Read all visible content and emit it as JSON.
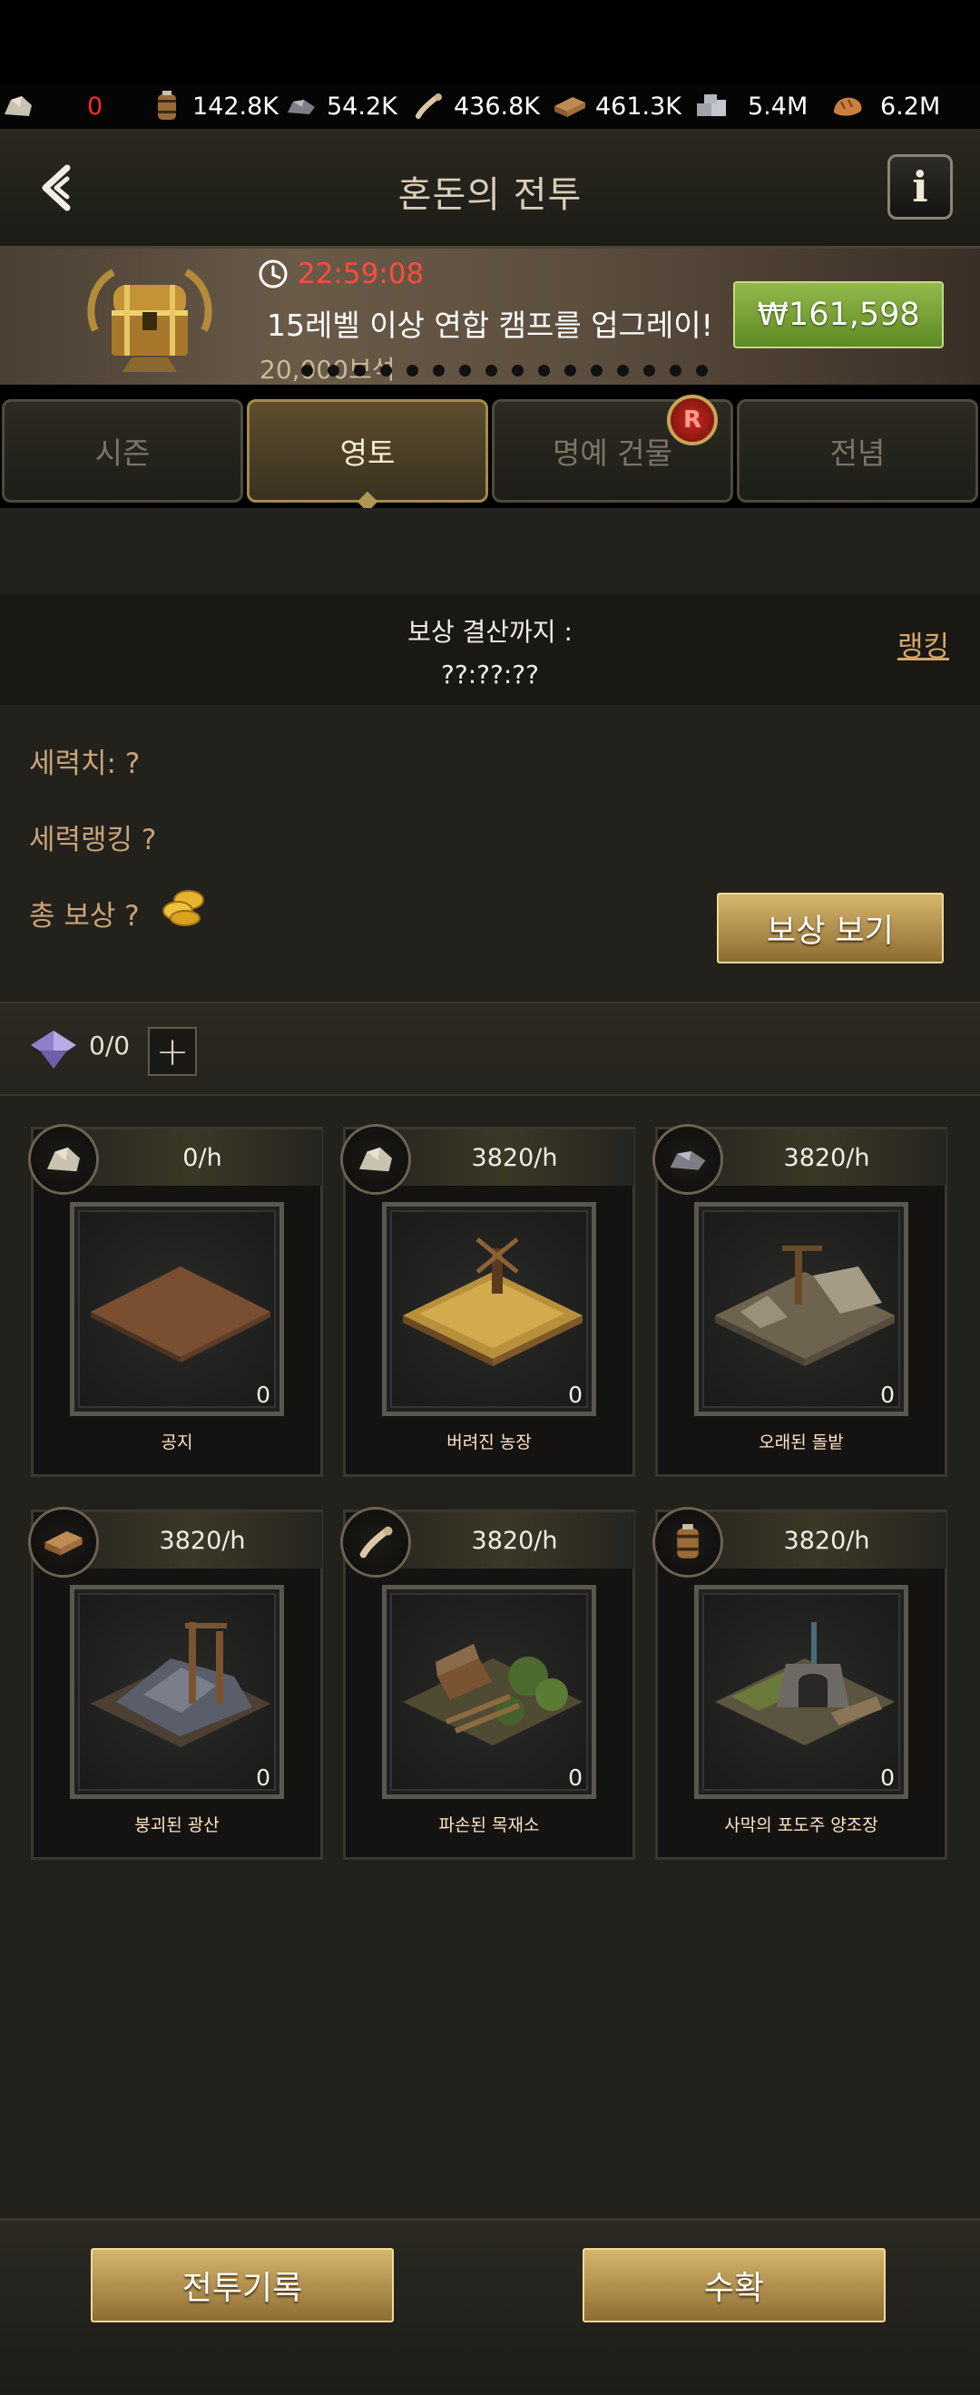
{
  "resources": [
    {
      "icon": "stone-ore-icon",
      "value": "0",
      "highlight": true
    },
    {
      "icon": "wine-barrel-icon",
      "value": "142.8K"
    },
    {
      "icon": "iron-ore-icon",
      "value": "54.2K"
    },
    {
      "icon": "bone-icon",
      "value": "436.8K"
    },
    {
      "icon": "wood-icon",
      "value": "461.3K"
    },
    {
      "icon": "metal-icon",
      "value": "5.4M"
    },
    {
      "icon": "bread-icon",
      "value": "6.2M"
    }
  ],
  "header": {
    "title": "혼돈의 전투"
  },
  "promo": {
    "timer": "22:59:08",
    "text": "15레벨 이상 연합 캠프를 업그레이!",
    "sub": "20,000보석",
    "price": "₩161,598",
    "dot_count": 16
  },
  "tabs": [
    {
      "label": "시즌",
      "active": false
    },
    {
      "label": "영토",
      "active": true
    },
    {
      "label": "명예 건물",
      "active": false,
      "badge": "R"
    },
    {
      "label": "전념",
      "active": false
    }
  ],
  "settlement": {
    "label": "보상 결산까지 :",
    "time": "??:??:??",
    "ranking_link": "랭킹"
  },
  "stats": {
    "power": "세력치: ?",
    "power_rank": "세력랭킹 ?",
    "total_reward": "총 보상 ?"
  },
  "reward_button": "보상 보기",
  "slots": {
    "count": "0/0",
    "plus": "+"
  },
  "territories": [
    {
      "name": "공지",
      "rate": "0/h",
      "icon": "stone-ore-icon",
      "count": "0"
    },
    {
      "name": "버려진 농장",
      "rate": "3820/h",
      "icon": "stone-ore-icon",
      "count": "0"
    },
    {
      "name": "오래된 돌밭",
      "rate": "3820/h",
      "icon": "iron-ore-icon",
      "count": "0"
    },
    {
      "name": "붕괴된 광산",
      "rate": "3820/h",
      "icon": "wood-icon",
      "count": "0"
    },
    {
      "name": "파손된 목재소",
      "rate": "3820/h",
      "icon": "bone-icon",
      "count": "0"
    },
    {
      "name": "사막의 포도주 양조장",
      "rate": "3820/h",
      "icon": "wine-barrel-icon",
      "count": "0"
    }
  ],
  "bottom": {
    "battle_log": "전투기록",
    "harvest": "수확"
  },
  "colors": {
    "accent_gold": "#b09554",
    "price_green": "#7aa83a",
    "timer_red": "#ff4d3d",
    "link_orange": "#d6a56a"
  }
}
